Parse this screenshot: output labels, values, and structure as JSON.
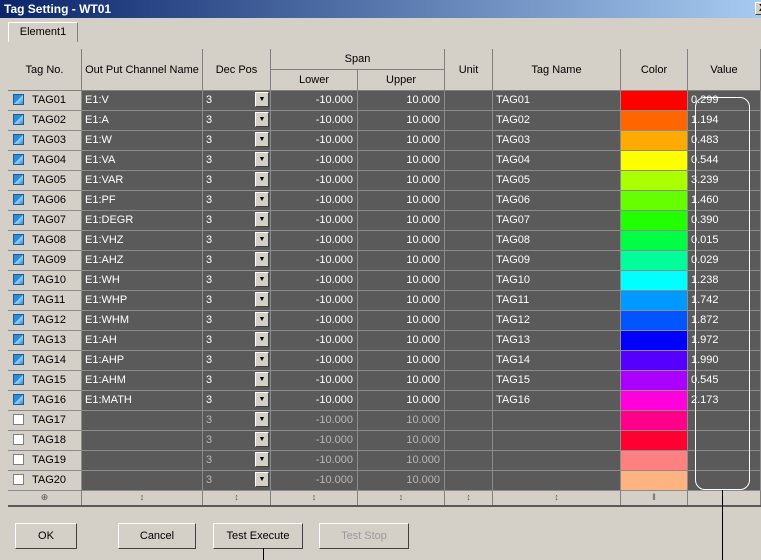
{
  "window": {
    "title": "Tag Setting - WT01",
    "close_glyph": "X"
  },
  "tabs": [
    {
      "label": "Element1"
    }
  ],
  "columns": {
    "tag_no": "Tag No.",
    "channel": "Out Put Channel Name",
    "dec_pos": "Dec Pos",
    "span": "Span",
    "lower": "Lower",
    "upper": "Upper",
    "unit": "Unit",
    "tag_name": "Tag Name",
    "color": "Color",
    "value": "Value"
  },
  "rows": [
    {
      "tag": "TAG01",
      "checked": true,
      "channel": "E1:V",
      "dec": "3",
      "lower": "-10.000",
      "upper": "10.000",
      "unit": "",
      "name": "TAG01",
      "color": "#ff0000",
      "value": "0.299"
    },
    {
      "tag": "TAG02",
      "checked": true,
      "channel": "E1:A",
      "dec": "3",
      "lower": "-10.000",
      "upper": "10.000",
      "unit": "",
      "name": "TAG02",
      "color": "#ff6600",
      "value": "1.194"
    },
    {
      "tag": "TAG03",
      "checked": true,
      "channel": "E1:W",
      "dec": "3",
      "lower": "-10.000",
      "upper": "10.000",
      "unit": "",
      "name": "TAG03",
      "color": "#ffaa00",
      "value": "0.483"
    },
    {
      "tag": "TAG04",
      "checked": true,
      "channel": "E1:VA",
      "dec": "3",
      "lower": "-10.000",
      "upper": "10.000",
      "unit": "",
      "name": "TAG04",
      "color": "#ffff00",
      "value": "0.544"
    },
    {
      "tag": "TAG05",
      "checked": true,
      "channel": "E1:VAR",
      "dec": "3",
      "lower": "-10.000",
      "upper": "10.000",
      "unit": "",
      "name": "TAG05",
      "color": "#aaff00",
      "value": "3.239"
    },
    {
      "tag": "TAG06",
      "checked": true,
      "channel": "E1:PF",
      "dec": "3",
      "lower": "-10.000",
      "upper": "10.000",
      "unit": "",
      "name": "TAG06",
      "color": "#66ff00",
      "value": "1.460"
    },
    {
      "tag": "TAG07",
      "checked": true,
      "channel": "E1:DEGR",
      "dec": "3",
      "lower": "-10.000",
      "upper": "10.000",
      "unit": "",
      "name": "TAG07",
      "color": "#22ff00",
      "value": "0.390"
    },
    {
      "tag": "TAG08",
      "checked": true,
      "channel": "E1:VHZ",
      "dec": "3",
      "lower": "-10.000",
      "upper": "10.000",
      "unit": "",
      "name": "TAG08",
      "color": "#00ff44",
      "value": "0.015"
    },
    {
      "tag": "TAG09",
      "checked": true,
      "channel": "E1:AHZ",
      "dec": "3",
      "lower": "-10.000",
      "upper": "10.000",
      "unit": "",
      "name": "TAG09",
      "color": "#00ff99",
      "value": "0.029"
    },
    {
      "tag": "TAG10",
      "checked": true,
      "channel": "E1:WH",
      "dec": "3",
      "lower": "-10.000",
      "upper": "10.000",
      "unit": "",
      "name": "TAG10",
      "color": "#00ffff",
      "value": "1.238"
    },
    {
      "tag": "TAG11",
      "checked": true,
      "channel": "E1:WHP",
      "dec": "3",
      "lower": "-10.000",
      "upper": "10.000",
      "unit": "",
      "name": "TAG11",
      "color": "#0099ff",
      "value": "1.742"
    },
    {
      "tag": "TAG12",
      "checked": true,
      "channel": "E1:WHM",
      "dec": "3",
      "lower": "-10.000",
      "upper": "10.000",
      "unit": "",
      "name": "TAG12",
      "color": "#0055ff",
      "value": "1.872"
    },
    {
      "tag": "TAG13",
      "checked": true,
      "channel": "E1:AH",
      "dec": "3",
      "lower": "-10.000",
      "upper": "10.000",
      "unit": "",
      "name": "TAG13",
      "color": "#0000ff",
      "value": "1.972"
    },
    {
      "tag": "TAG14",
      "checked": true,
      "channel": "E1:AHP",
      "dec": "3",
      "lower": "-10.000",
      "upper": "10.000",
      "unit": "",
      "name": "TAG14",
      "color": "#5500ff",
      "value": "1.990"
    },
    {
      "tag": "TAG15",
      "checked": true,
      "channel": "E1:AHM",
      "dec": "3",
      "lower": "-10.000",
      "upper": "10.000",
      "unit": "",
      "name": "TAG15",
      "color": "#aa00ff",
      "value": "0.545"
    },
    {
      "tag": "TAG16",
      "checked": true,
      "channel": "E1:MATH",
      "dec": "3",
      "lower": "-10.000",
      "upper": "10.000",
      "unit": "",
      "name": "TAG16",
      "color": "#ff00dd",
      "value": "2.173"
    },
    {
      "tag": "TAG17",
      "checked": false,
      "channel": "",
      "dec": "3",
      "lower": "-10.000",
      "upper": "10.000",
      "unit": "",
      "name": "",
      "color": "#ff0088",
      "value": ""
    },
    {
      "tag": "TAG18",
      "checked": false,
      "channel": "",
      "dec": "3",
      "lower": "-10.000",
      "upper": "10.000",
      "unit": "",
      "name": "",
      "color": "#ff0033",
      "value": ""
    },
    {
      "tag": "TAG19",
      "checked": false,
      "channel": "",
      "dec": "3",
      "lower": "-10.000",
      "upper": "10.000",
      "unit": "",
      "name": "",
      "color": "#ff8080",
      "value": ""
    },
    {
      "tag": "TAG20",
      "checked": false,
      "channel": "",
      "dec": "3",
      "lower": "-10.000",
      "upper": "10.000",
      "unit": "",
      "name": "",
      "color": "#ffb380",
      "value": ""
    }
  ],
  "footer_glyphs": [
    "⊕",
    "↕",
    "↕",
    "↕",
    "↕",
    "↕",
    "↕",
    "‖"
  ],
  "buttons": {
    "ok": "OK",
    "cancel": "Cancel",
    "test_execute": "Test Execute",
    "test_stop": "Test Stop"
  }
}
